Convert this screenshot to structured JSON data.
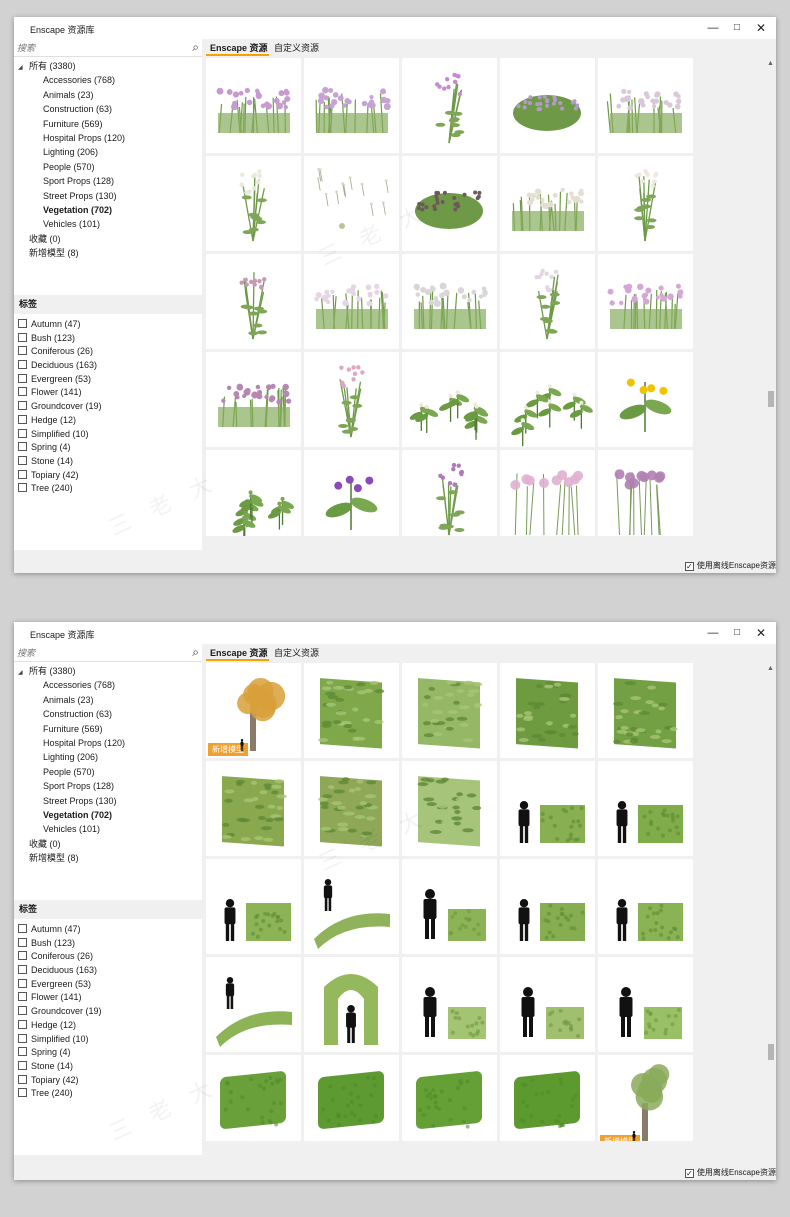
{
  "windows": [
    {
      "title": "Enscape 资源库",
      "search_placeholder": "搜索",
      "tabs": [
        "Enscape 资源",
        "自定义资源"
      ],
      "tree_root": "所有 (3380)",
      "categories": [
        "Accessories (768)",
        "Animals (23)",
        "Construction (63)",
        "Furniture (569)",
        "Hospital Props (120)",
        "Lighting (206)",
        "People (570)",
        "Sport Props (128)",
        "Street Props (130)",
        "Vegetation (702)",
        "Vehicles (101)"
      ],
      "selected_category": "Vegetation (702)",
      "top_items": [
        "收藏 (0)",
        "新增模型 (8)"
      ],
      "tags_header": "标签",
      "tags": [
        "Autumn (47)",
        "Bush (123)",
        "Coniferous (26)",
        "Deciduous (163)",
        "Evergreen (53)",
        "Flower (141)",
        "Groundcover (19)",
        "Hedge (12)",
        "Simplified (10)",
        "Spring (4)",
        "Stone (14)",
        "Topiary (42)",
        "Tree (240)"
      ],
      "offline_label": "使用离线Enscape资源",
      "offline_checked": true,
      "scroll_fraction": 0.68,
      "assets": [
        {
          "kind": "flowerbed",
          "color": "#c79ad0"
        },
        {
          "kind": "flowerbed",
          "color": "#c7a3d3"
        },
        {
          "kind": "stem",
          "color": "#c68ad0"
        },
        {
          "kind": "bush",
          "color": "#b59ac9"
        },
        {
          "kind": "flowerbed",
          "color": "#d8c8d8"
        },
        {
          "kind": "stem",
          "color": "#e6ead8"
        },
        {
          "kind": "sparse",
          "color": "#d6d6c6"
        },
        {
          "kind": "bush",
          "color": "#6a5a5a"
        },
        {
          "kind": "flowerbed",
          "color": "#e3dfd3"
        },
        {
          "kind": "stem",
          "color": "#efe9dd"
        },
        {
          "kind": "stem",
          "color": "#c898b2"
        },
        {
          "kind": "flowerbed",
          "color": "#e6d6e3"
        },
        {
          "kind": "flowerbed",
          "color": "#d8d6d6"
        },
        {
          "kind": "stem",
          "color": "#e3d6e3"
        },
        {
          "kind": "flowerbed",
          "color": "#d6a6d6"
        },
        {
          "kind": "flowerbed",
          "color": "#b687b0"
        },
        {
          "kind": "stem",
          "color": "#e0a6c0"
        },
        {
          "kind": "leafy",
          "color": "#f1ead2"
        },
        {
          "kind": "leafy",
          "color": "#ecece0"
        },
        {
          "kind": "flower",
          "color": "#f2c200"
        },
        {
          "kind": "leafy",
          "color": "#7aa84e"
        },
        {
          "kind": "flower",
          "color": "#8a4ab8"
        },
        {
          "kind": "stem",
          "color": "#b27ab8"
        },
        {
          "kind": "tallstems",
          "color": "#e0b0d0"
        },
        {
          "kind": "tallstems",
          "color": "#b080b0"
        }
      ]
    },
    {
      "title": "Enscape 资源库",
      "search_placeholder": "搜索",
      "tabs": [
        "Enscape 资源",
        "自定义资源"
      ],
      "tree_root": "所有 (3380)",
      "categories": [
        "Accessories (768)",
        "Animals (23)",
        "Construction (63)",
        "Furniture (569)",
        "Hospital Props (120)",
        "Lighting (206)",
        "People (570)",
        "Sport Props (128)",
        "Street Props (130)",
        "Vegetation (702)",
        "Vehicles (101)"
      ],
      "selected_category": "Vegetation (702)",
      "top_items": [
        "收藏 (0)",
        "新增模型 (8)"
      ],
      "tags_header": "标签",
      "tags": [
        "Autumn (47)",
        "Bush (123)",
        "Coniferous (26)",
        "Deciduous (163)",
        "Evergreen (53)",
        "Flower (141)",
        "Groundcover (19)",
        "Hedge (12)",
        "Simplified (10)",
        "Spring (4)",
        "Stone (14)",
        "Topiary (42)",
        "Tree (240)"
      ],
      "offline_label": "使用离线Enscape资源",
      "offline_checked": true,
      "scroll_fraction": 0.78,
      "assets": [
        {
          "kind": "tree",
          "color": "#d8a03a",
          "badge": "新增模型"
        },
        {
          "kind": "wall",
          "color": "#7fa84a"
        },
        {
          "kind": "wall",
          "color": "#94b866"
        },
        {
          "kind": "wall",
          "color": "#6e9a40"
        },
        {
          "kind": "wall",
          "color": "#74a044"
        },
        {
          "kind": "wall",
          "color": "#8aa84e"
        },
        {
          "kind": "wall",
          "color": "#8ea858"
        },
        {
          "kind": "wall",
          "color": "#a6c47a"
        },
        {
          "kind": "person-hedge",
          "color": "#88b050"
        },
        {
          "kind": "person-hedge",
          "color": "#80ac4a"
        },
        {
          "kind": "person-hedge",
          "color": "#8cb456"
        },
        {
          "kind": "curve-hedge",
          "color": "#90b25a"
        },
        {
          "kind": "person-box",
          "color": "#8cb456"
        },
        {
          "kind": "person-hedge",
          "color": "#86ae50"
        },
        {
          "kind": "person-hedge",
          "color": "#8ab454"
        },
        {
          "kind": "curve-hedge",
          "color": "#8cb456"
        },
        {
          "kind": "arch",
          "color": "#94b85c"
        },
        {
          "kind": "person-box",
          "color": "#a4c474"
        },
        {
          "kind": "person-box",
          "color": "#a0c070"
        },
        {
          "kind": "person-box",
          "color": "#9ac066"
        },
        {
          "kind": "hedge-block",
          "color": "#6aa03a"
        },
        {
          "kind": "hedge-block",
          "color": "#5e9a32"
        },
        {
          "kind": "hedge-block",
          "color": "#64a036"
        },
        {
          "kind": "hedge-block",
          "color": "#5c9a30"
        },
        {
          "kind": "tree",
          "color": "#8aaa5a",
          "badge": "新增模型"
        }
      ]
    }
  ]
}
